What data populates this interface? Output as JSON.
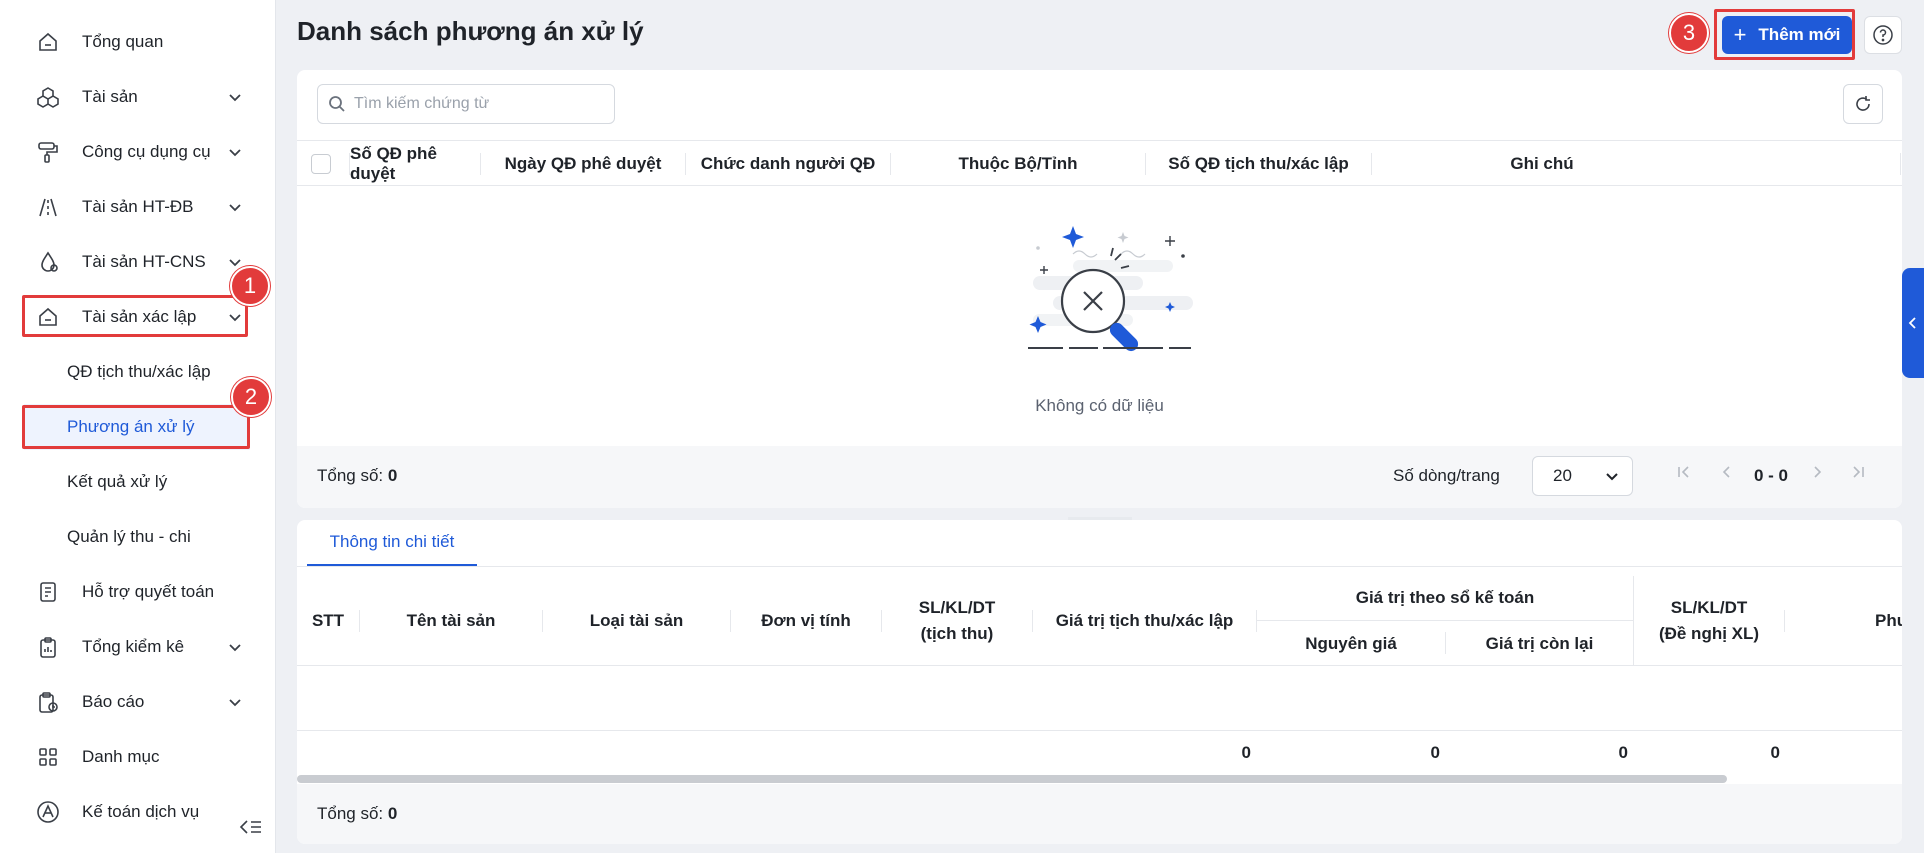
{
  "sidebar": {
    "items": [
      {
        "label": "Tổng quan",
        "icon": "home-icon"
      },
      {
        "label": "Tài sản",
        "icon": "cubes-icon"
      },
      {
        "label": "Công cụ dụng cụ",
        "icon": "paint-roller-icon"
      },
      {
        "label": "Tài sản HT-ĐB",
        "icon": "road-icon"
      },
      {
        "label": "Tài sản HT-CNS",
        "icon": "water-drop-icon"
      },
      {
        "label": "Tài sản xác lập",
        "icon": "inbox-icon"
      },
      {
        "label": "Hỗ trợ quyết toán",
        "icon": "document-icon"
      },
      {
        "label": "Tổng kiểm kê",
        "icon": "clipboard-icon"
      },
      {
        "label": "Báo cáo",
        "icon": "report-icon"
      },
      {
        "label": "Danh mục",
        "icon": "grid-icon"
      },
      {
        "label": "Kế toán dịch vụ",
        "icon": "accounting-icon"
      }
    ],
    "sub_items": [
      {
        "label": "QĐ tịch thu/xác lập"
      },
      {
        "label": "Phương án xử lý"
      },
      {
        "label": "Kết quả xử lý"
      },
      {
        "label": "Quản lý thu - chi"
      }
    ]
  },
  "annotations": {
    "step1": "1",
    "step2": "2",
    "step3": "3",
    "color": "#e23b3b"
  },
  "header": {
    "title": "Danh sách phương án xử lý",
    "add_button": "Thêm mới",
    "add_button_plus": "+"
  },
  "search": {
    "placeholder": "Tìm kiếm chứng từ"
  },
  "table": {
    "columns": [
      "Số QĐ phê duyệt",
      "Ngày QĐ phê duyệt",
      "Chức danh người QĐ",
      "Thuộc Bộ/Tỉnh",
      "Số QĐ tịch thu/xác lập",
      "Ghi chú"
    ],
    "empty_text": "Không có dữ liệu",
    "total_label": "Tổng số:",
    "total_value": "0",
    "rows_per_page_label": "Số dòng/trang",
    "rows_per_page_value": "20",
    "range": "0 - 0"
  },
  "detail": {
    "tab": "Thông tin chi tiết",
    "columns": {
      "stt": "STT",
      "name": "Tên tài sản",
      "type": "Loại tài sản",
      "unit": "Đơn vị tính",
      "qty_seized_1": "SL/KL/DT",
      "qty_seized_2": "(tịch thu)",
      "value_seized": "Giá trị tịch thu/xác lập",
      "book_value_group": "Giá trị theo sổ kế toán",
      "original_cost": "Nguyên giá",
      "remaining_value": "Giá trị còn lại",
      "qty_proposed_1": "SL/KL/DT",
      "qty_proposed_2": "(Đề nghị XL)",
      "truncated": "Phư"
    },
    "sums": {
      "value_seized": "0",
      "original_cost": "0",
      "remaining_value": "0",
      "qty_proposed": "0"
    },
    "total_label": "Tổng số:",
    "total_value": "0"
  },
  "colors": {
    "accent": "#1f5ad8",
    "highlight": "#e23b3b"
  }
}
